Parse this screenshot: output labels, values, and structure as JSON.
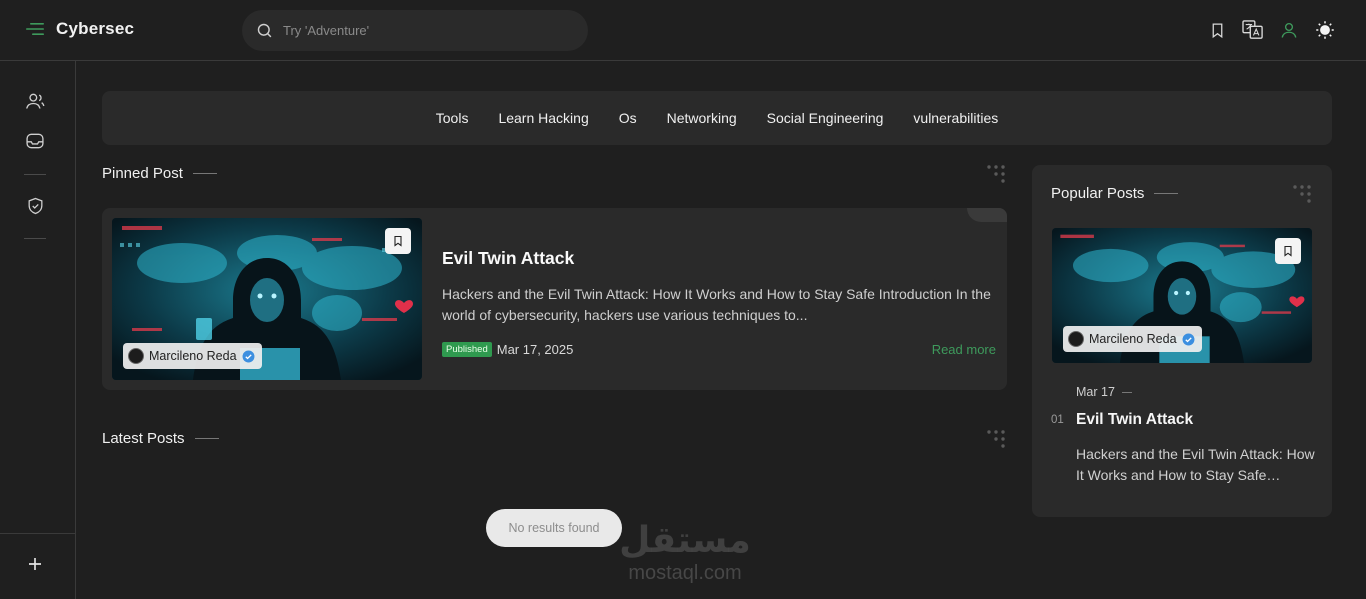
{
  "header": {
    "brand": "Cybersec",
    "search_placeholder": "Try 'Adventure'",
    "icons": [
      "bookmark-icon",
      "translate-icon",
      "user-icon",
      "theme-sun-icon"
    ]
  },
  "sidebar": {
    "icons": [
      "users-icon",
      "inbox-icon",
      "shield-icon",
      "plus-icon"
    ]
  },
  "categories": [
    "Tools",
    "Learn Hacking",
    "Os",
    "Networking",
    "Social Engineering",
    "vulnerabilities"
  ],
  "pinned": {
    "section_title": "Pinned Post",
    "post": {
      "title": "Evil Twin Attack",
      "excerpt": "Hackers and the Evil Twin Attack: How It Works and How to Stay Safe Introduction In the world of cybersecurity, hackers use various techniques to...",
      "status": "Published",
      "date": "Mar 17, 2025",
      "read_more": "Read more",
      "author": "Marcileno Reda"
    }
  },
  "latest": {
    "section_title": "Latest Posts",
    "empty_message": "No results found"
  },
  "popular": {
    "section_title": "Popular Posts",
    "item": {
      "author": "Marcileno Reda",
      "date": "Mar 17",
      "rank": "01",
      "title": "Evil Twin Attack",
      "excerpt": "Hackers and the Evil Twin Attack: How It Works and How to Stay Safe Introduction In the world of cybersecurity..."
    }
  },
  "watermark": {
    "arabic": "مستقل",
    "latin": "mostaql.com"
  },
  "colors": {
    "background": "#1f1f1f",
    "card": "#2a2a2a",
    "accent_green": "#3e9a5c",
    "badge_green": "#2f9a4f",
    "verified_blue": "#3b8fe0"
  }
}
